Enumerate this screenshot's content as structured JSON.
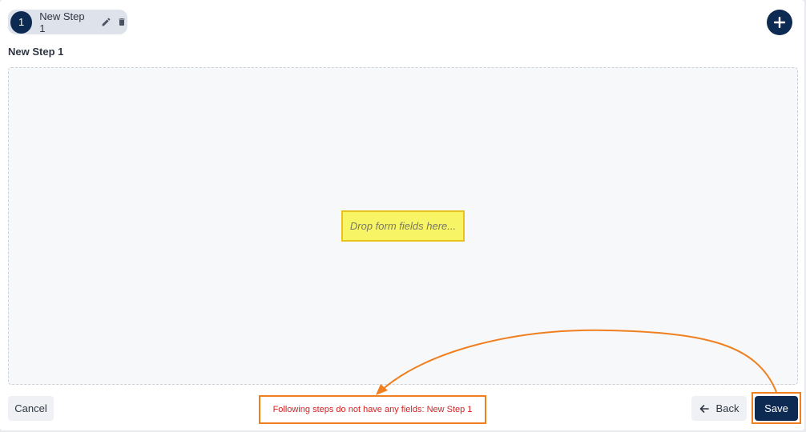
{
  "step_tab": {
    "number": "1",
    "name": "New Step 1",
    "edit_icon": "pencil-icon",
    "delete_icon": "trash-icon"
  },
  "add_step_icon": "plus-icon",
  "step_heading": "New Step 1",
  "drop_zone": {
    "hint": "Drop form fields here..."
  },
  "footer": {
    "cancel_label": "Cancel",
    "back_label": "Back",
    "back_icon": "arrow-left-icon",
    "save_label": "Save",
    "error_message": "Following steps do not have any fields: New Step 1"
  },
  "colors": {
    "primary": "#0d2a52",
    "annotation": "#f07f1f",
    "error": "#d82020",
    "highlight": "#f7f465"
  }
}
